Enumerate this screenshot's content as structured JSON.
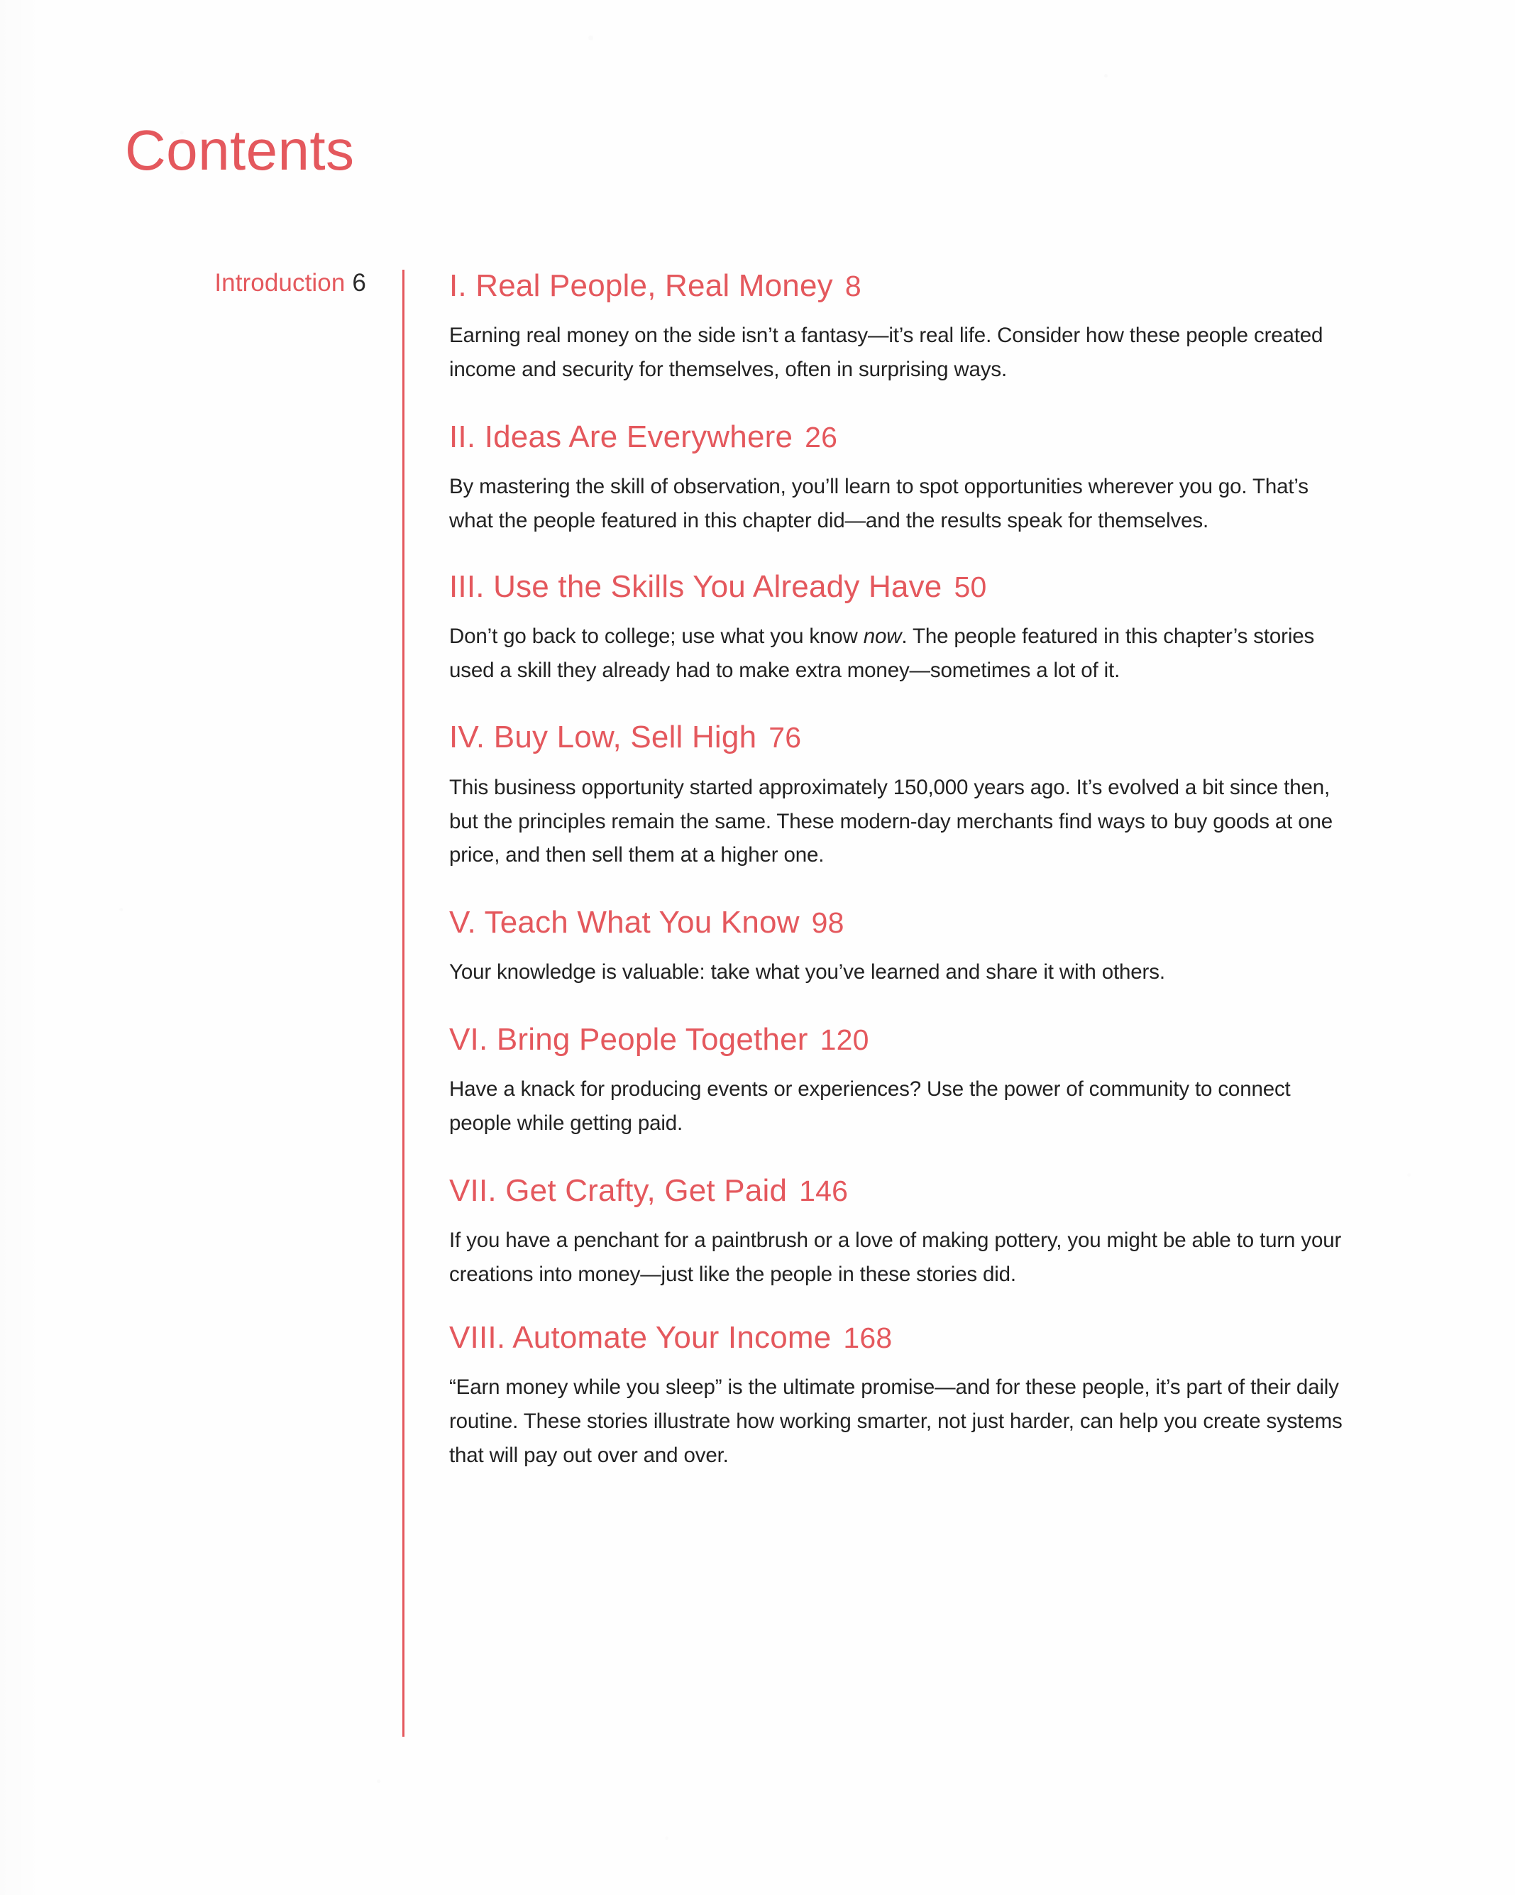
{
  "document": {
    "title": "Contents",
    "accent_color": "#e4585d",
    "body_text_color": "#222222",
    "background_color": "#fefefe"
  },
  "front_matter": {
    "label": "Introduction",
    "page": "6"
  },
  "chapters": [
    {
      "title": "I. Real People, Real Money",
      "page": "8",
      "description": "Earning real money on the side isn’t a fantasy—it’s real life. Consider how these people created income and security for themselves, often in surprising ways."
    },
    {
      "title": "II. Ideas Are Everywhere",
      "page": "26",
      "description": "By mastering the skill of observation, you’ll learn to spot opportunities wherever you go. That’s what the people featured in this chapter did—and the results speak for themselves."
    },
    {
      "title": "III. Use the Skills You Already Have",
      "page": "50",
      "description_before": "Don’t go back to college; use what you know ",
      "description_emphasis": "now",
      "description_after": ". The people featured in this chapter’s stories used a skill they already had to make extra money—sometimes a lot of it."
    },
    {
      "title": "IV. Buy Low, Sell High",
      "page": "76",
      "description": "This business opportunity started approximately 150,000 years ago. It’s evolved a bit since then, but the principles remain the same. These modern-day merchants find ways to buy goods at one price, and then sell them at a higher one."
    },
    {
      "title": "V. Teach What You Know",
      "page": "98",
      "description": "Your knowledge is valuable: take what you’ve learned and share it with others."
    },
    {
      "title": "VI. Bring People Together",
      "page": "120",
      "description": "Have a knack for producing events or experiences? Use the power of community to connect people while getting paid."
    },
    {
      "title": "VII. Get Crafty, Get Paid",
      "page": "146",
      "description": "If you have a penchant for a paintbrush or a love of making pottery, you might be able to turn your creations into money—just like the people in these stories did."
    },
    {
      "title": "VIII. Automate Your Income",
      "page": "168",
      "description": "“Earn money while you sleep” is the ultimate promise—and for these people, it’s part of their daily routine. These stories illustrate how working smarter, not just harder, can help you create systems that will pay out over and over."
    }
  ]
}
